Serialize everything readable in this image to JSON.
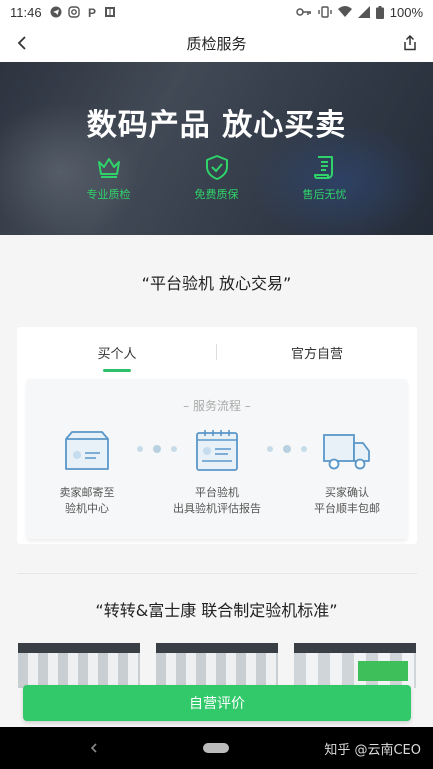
{
  "status_bar": {
    "time": "11:46",
    "battery": "100%",
    "icons": [
      "telegram-icon",
      "instagram-icon",
      "parking-icon",
      "book-icon",
      "key-icon",
      "vibrate-icon",
      "wifi-icon",
      "signal-icon",
      "battery-icon"
    ]
  },
  "nav": {
    "title": "质检服务",
    "back_icon": "chevron-left-icon",
    "share_icon": "share-icon"
  },
  "hero": {
    "title": "数码产品 放心买卖",
    "features": [
      {
        "label": "专业质检",
        "icon": "crown-icon"
      },
      {
        "label": "免费质保",
        "icon": "shield-check-icon"
      },
      {
        "label": "售后无忧",
        "icon": "receipt-icon"
      }
    ],
    "accent_color": "#2fd36a"
  },
  "section1": {
    "title": "“平台验机 放心交易”"
  },
  "card": {
    "tabs": [
      {
        "label": "买个人",
        "active": true
      },
      {
        "label": "官方自营",
        "active": false
      }
    ],
    "process_title": "– 服务流程 –",
    "steps": [
      {
        "line1": "卖家邮寄至",
        "line2": "验机中心",
        "icon": "package-icon"
      },
      {
        "line1": "平台验机",
        "line2": "出具验机评估报告",
        "icon": "calendar-report-icon"
      },
      {
        "line1": "买家确认",
        "line2": "平台顺丰包邮",
        "icon": "truck-icon"
      }
    ]
  },
  "section2": {
    "title": "“转转&富士康 联合制定验机标准”"
  },
  "action_button": {
    "label": "自营评价",
    "color": "#31c96a"
  },
  "system_nav": {
    "watermark": "知乎 @云南CEO"
  }
}
